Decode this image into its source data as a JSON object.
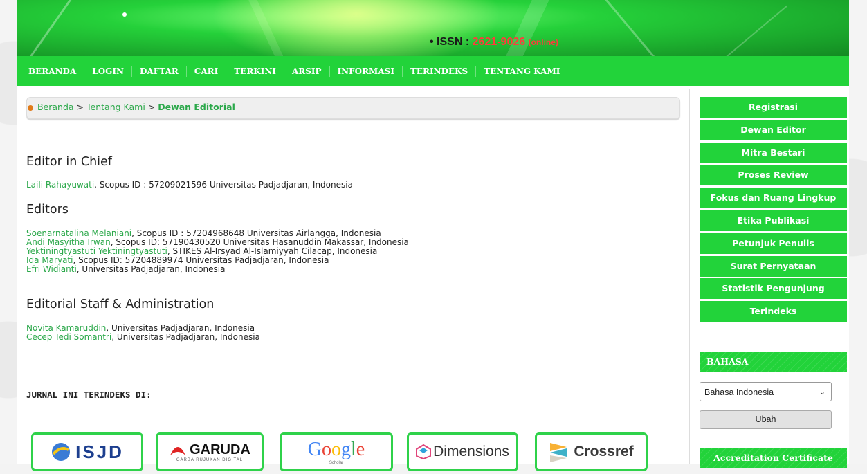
{
  "header": {
    "issn_prefix": "• ISSN :",
    "issn_number": "2621-9026",
    "issn_suffix": "(online)"
  },
  "nav": {
    "items": [
      "BERANDA",
      "LOGIN",
      "DAFTAR",
      "CARI",
      "TERKINI",
      "ARSIP",
      "INFORMASI",
      "TERINDEKS",
      "TENTANG KAMI"
    ]
  },
  "breadcrumb": {
    "home": "Beranda",
    "sep": ">",
    "about": "Tentang Kami",
    "current": "Dewan Editorial"
  },
  "content": {
    "editor_in_chief_heading": "Editor in Chief",
    "editor_in_chief": [
      {
        "name": "Laili Rahayuwati",
        "detail": ", Scopus ID : 57209021596 Universitas Padjadjaran, Indonesia"
      }
    ],
    "editors_heading": "Editors",
    "editors": [
      {
        "name": "Soenarnatalina Melaniani",
        "detail": ", Scopus ID : 57204968648 Universitas Airlangga, Indonesia"
      },
      {
        "name": "Andi Masyitha Irwan",
        "detail": ", Scopus ID: 57190430520 Universitas Hasanuddin Makassar, Indonesia"
      },
      {
        "name": "Yektiningtyastuti Yektiningtyastuti",
        "detail": ", STIKES Al-Irsyad Al-Islamiyyah Cilacap, Indonesia"
      },
      {
        "name": "Ida Maryati",
        "detail": ", Scopus ID: 57204889974 Universitas Padjadjaran, Indonesia"
      },
      {
        "name": "Efri Widianti",
        "detail": ", Universitas Padjadjaran, Indonesia"
      }
    ],
    "staff_heading": "Editorial Staff & Administration",
    "staff": [
      {
        "name": "Novita Kamaruddin",
        "detail": ", Universitas Padjadjaran, Indonesia"
      },
      {
        "name": "Cecep Tedi Somantri",
        "detail": ", Universitas Padjadjaran, Indonesia"
      }
    ],
    "indexed_title": "JURNAL INI TERINDEKS DI:",
    "logos": [
      "ISJD",
      "GARUDA",
      "Google",
      "Dimensions",
      "Crossref"
    ],
    "garuda_tagline": "GARBA RUJUKAN DIGITAL",
    "google_sub": "Scholar"
  },
  "sidebar": {
    "menu": [
      "Registrasi",
      "Dewan Editor",
      "Mitra Bestari",
      "Proses Review",
      "Fokus dan Ruang Lingkup",
      "Etika Publikasi",
      "Petunjuk Penulis",
      "Surat Pernyataan",
      "Statistik Pengunjung",
      "Terindeks"
    ],
    "language_heading": "BAHASA",
    "language_selected": "Bahasa Indonesia",
    "change_button": "Ubah",
    "accreditation_heading": "Accreditation Certificate"
  },
  "colors": {
    "brand_green": "#22d33a",
    "link_green": "#2ba84a",
    "issn_red": "#ff3b3b"
  }
}
